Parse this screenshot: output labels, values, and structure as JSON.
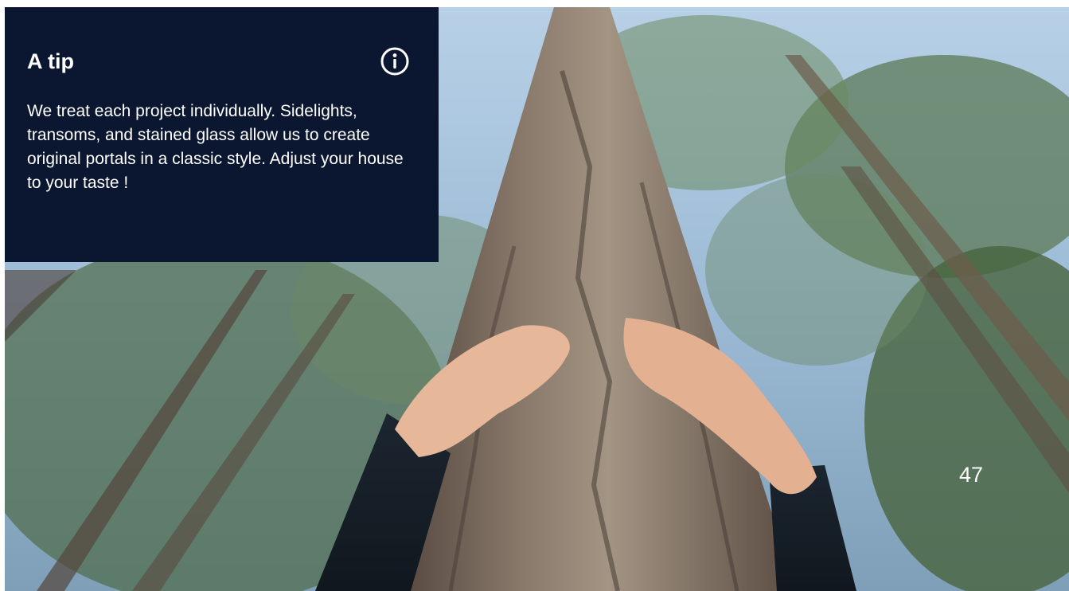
{
  "tip": {
    "title": "A tip",
    "body": "We treat each project individually. Sidelights, transoms, and stained glass allow us to create original portals in a classic style. Adjust your house to your taste !",
    "icon": "info-icon"
  },
  "page": {
    "number": "47"
  },
  "colors": {
    "panel_background": "#0b1730",
    "text": "#ffffff"
  }
}
